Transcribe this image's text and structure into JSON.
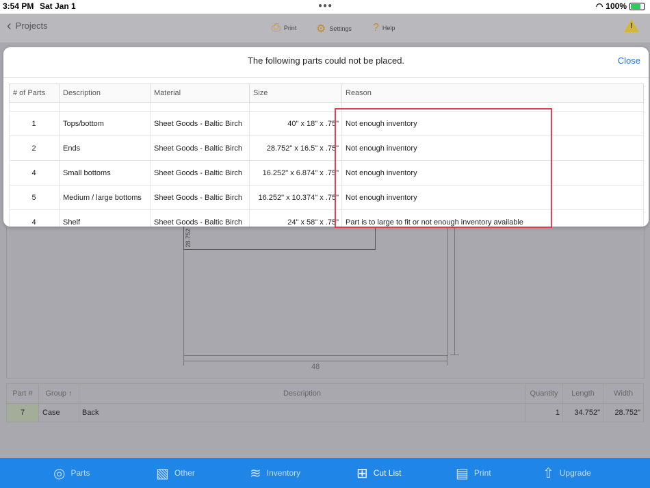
{
  "status": {
    "time": "3:54 PM",
    "date": "Sat Jan 1",
    "battery": "100%"
  },
  "nav": {
    "back_label": "Projects",
    "print": "Print",
    "settings": "Settings",
    "help": "Help"
  },
  "drawing": {
    "piece_label": "28.752",
    "width_label": "48"
  },
  "parts_table": {
    "headers": [
      "Part #",
      "Group",
      "Description",
      "Quantity",
      "Length",
      "Width"
    ],
    "rows": [
      {
        "part": "7",
        "group": "Case",
        "description": "Back",
        "quantity": "1",
        "length": "34.752\"",
        "width": "28.752\""
      }
    ]
  },
  "modal": {
    "title": "The following parts could not be placed.",
    "close": "Close",
    "headers": [
      "# of Parts",
      "Description",
      "Material",
      "Size",
      "Reason"
    ],
    "rows": [
      {
        "count": "1",
        "description": "Tops/bottom",
        "material": "Sheet Goods - Baltic Birch",
        "size": "40\" x 18\" x .75\"",
        "reason": "Not enough inventory"
      },
      {
        "count": "2",
        "description": "Ends",
        "material": "Sheet Goods - Baltic Birch",
        "size": "28.752\" x 16.5\" x .75\"",
        "reason": "Not enough inventory"
      },
      {
        "count": "4",
        "description": "Small bottoms",
        "material": "Sheet Goods - Baltic Birch",
        "size": "16.252\" x 6.874\" x .75\"",
        "reason": "Not enough inventory"
      },
      {
        "count": "5",
        "description": "Medium / large bottoms",
        "material": "Sheet Goods - Baltic Birch",
        "size": "16.252\" x 10.374\" x .75\"",
        "reason": "Not enough inventory"
      },
      {
        "count": "4",
        "description": "Shelf",
        "material": "Sheet Goods - Baltic Birch",
        "size": "24\" x 58\" x .75\"",
        "reason": "Part is to large to fit or not enough inventory available"
      }
    ]
  },
  "tabs": [
    {
      "label": "Parts",
      "icon": "tape-measure-icon"
    },
    {
      "label": "Other",
      "icon": "other-tools-icon"
    },
    {
      "label": "Inventory",
      "icon": "stack-icon"
    },
    {
      "label": "Cut List",
      "icon": "cut-list-icon"
    },
    {
      "label": "Print",
      "icon": "document-icon"
    },
    {
      "label": "Upgrade",
      "icon": "upgrade-arrow-icon"
    }
  ],
  "colors": {
    "accent": "#1f86e8",
    "highlight": "#e53e50",
    "warning": "#d6b637"
  }
}
